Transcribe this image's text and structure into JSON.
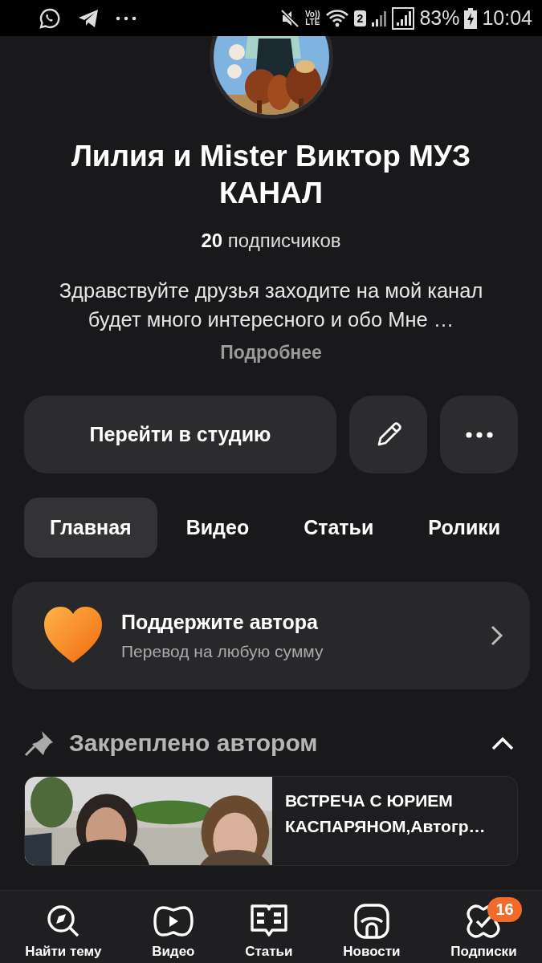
{
  "status_bar": {
    "volte": [
      "Vo))",
      "LTE"
    ],
    "sim": "2",
    "battery": "83%",
    "time": "10:04"
  },
  "channel": {
    "title": "Лилия и Mister Виктор МУЗ КАНАЛ",
    "subscribers_count": "20",
    "subscribers_label": "подписчиков",
    "description": "Здравствуйте друзья заходите на мой канал будет много интересного и обо Мне …",
    "more_link": "Подробнее"
  },
  "actions": {
    "studio_button": "Перейти в студию"
  },
  "tabs": [
    {
      "label": "Главная",
      "selected": true
    },
    {
      "label": "Видео",
      "selected": false
    },
    {
      "label": "Статьи",
      "selected": false
    },
    {
      "label": "Ролики",
      "selected": false
    }
  ],
  "support_card": {
    "title": "Поддержите автора",
    "subtitle": "Перевод на любую сумму"
  },
  "pinned": {
    "header": "Закреплено автором",
    "expanded": true,
    "post": {
      "title": "ВСТРЕЧА С ЮРИЕМ КАСПАРЯНОМ,Автогр…"
    }
  },
  "bottom_nav": [
    {
      "kind": "search",
      "label": "Найти тему"
    },
    {
      "kind": "video",
      "label": "Видео"
    },
    {
      "kind": "articles",
      "label": "Статьи"
    },
    {
      "kind": "news",
      "label": "Новости"
    },
    {
      "kind": "subscriptions",
      "label": "Подписки",
      "badge": "16"
    }
  ]
}
